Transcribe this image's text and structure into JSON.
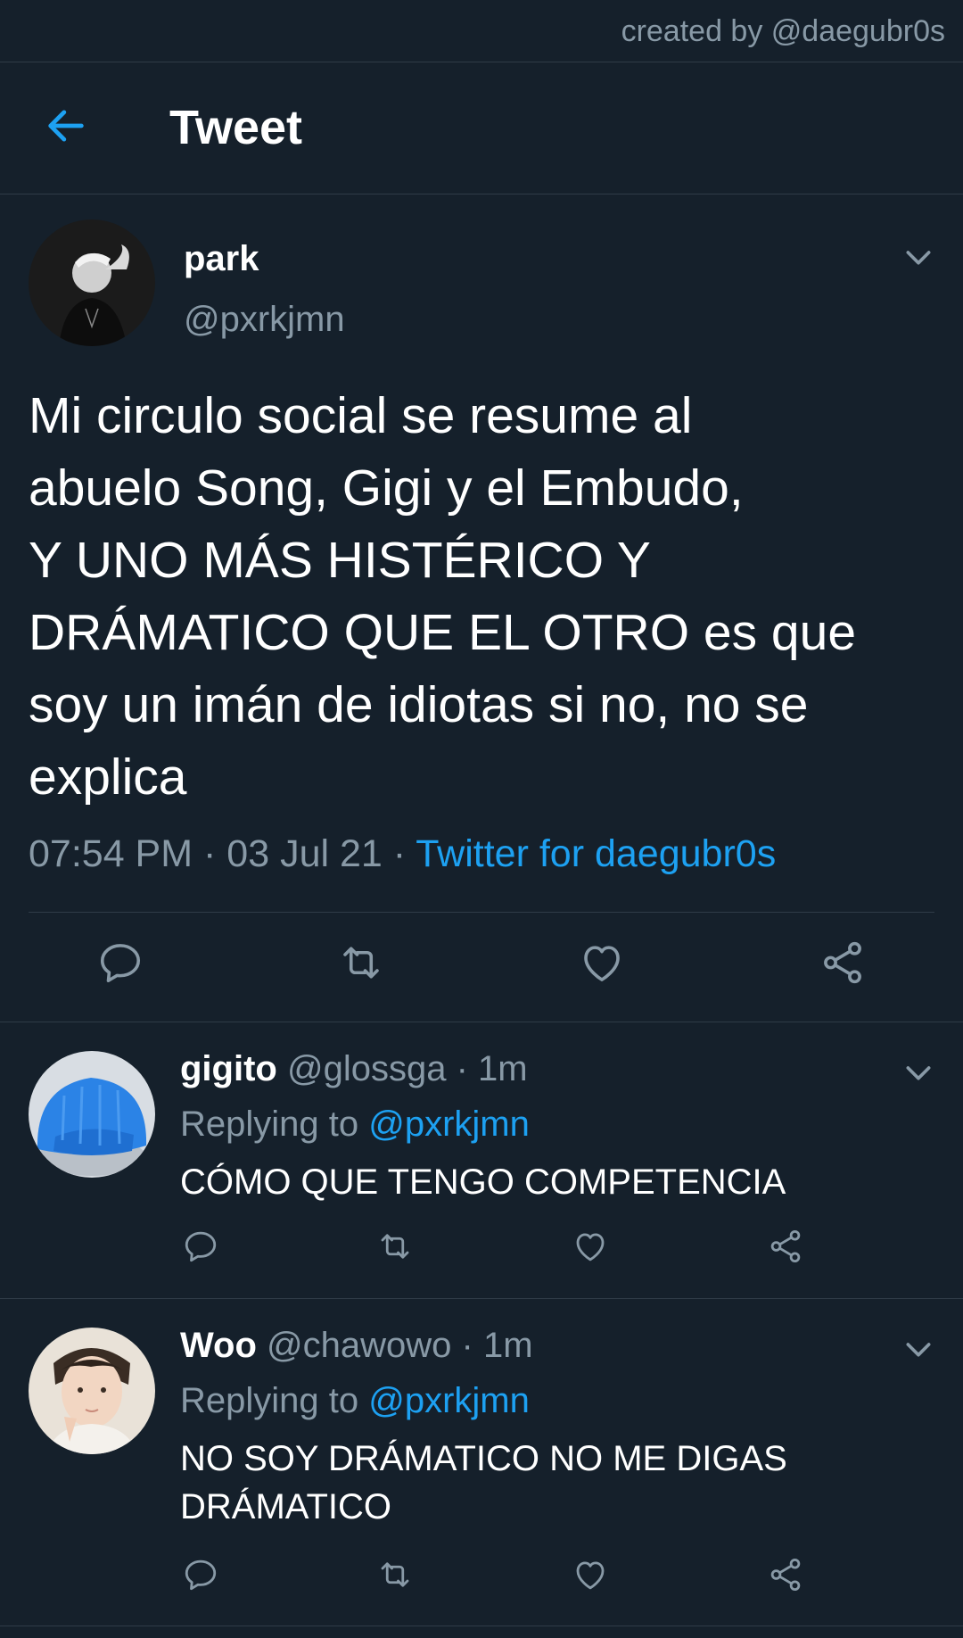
{
  "credit": "created by @daegubr0s",
  "header": {
    "title": "Tweet",
    "back_icon": "arrow-left-icon"
  },
  "colors": {
    "background": "#15202b",
    "accent": "#1da1f2",
    "muted": "#8899a6",
    "divider": "#2f3b47"
  },
  "main_tweet": {
    "name": "park",
    "handle": "@pxrkjmn",
    "text": "Mi circulo social se resume al\nabuelo Song, Gigi y el Embudo,\nY UNO MÁS HISTÉRICO Y\nDRÁMATICO QUE EL OTRO es que\nsoy un imán de idiotas si no, no se\nexplica",
    "time": "07:54 PM",
    "date": "03 Jul 21",
    "separator": "·",
    "client": "Twitter for daegubr0s",
    "actions": [
      "reply-icon",
      "retweet-icon",
      "like-icon",
      "share-icon"
    ]
  },
  "replies": [
    {
      "name": "gigito",
      "handle": "@glossga",
      "time": "1m",
      "replying_label": "Replying to",
      "replying_to": "@pxrkjmn",
      "text": "CÓMO QUE TENGO COMPETENCIA"
    },
    {
      "name": "Woo",
      "handle": "@chawowo",
      "time": "1m",
      "replying_label": "Replying to",
      "replying_to": "@pxrkjmn",
      "text": "NO SOY DRÁMATICO NO ME DIGAS DRÁMATICO"
    }
  ]
}
